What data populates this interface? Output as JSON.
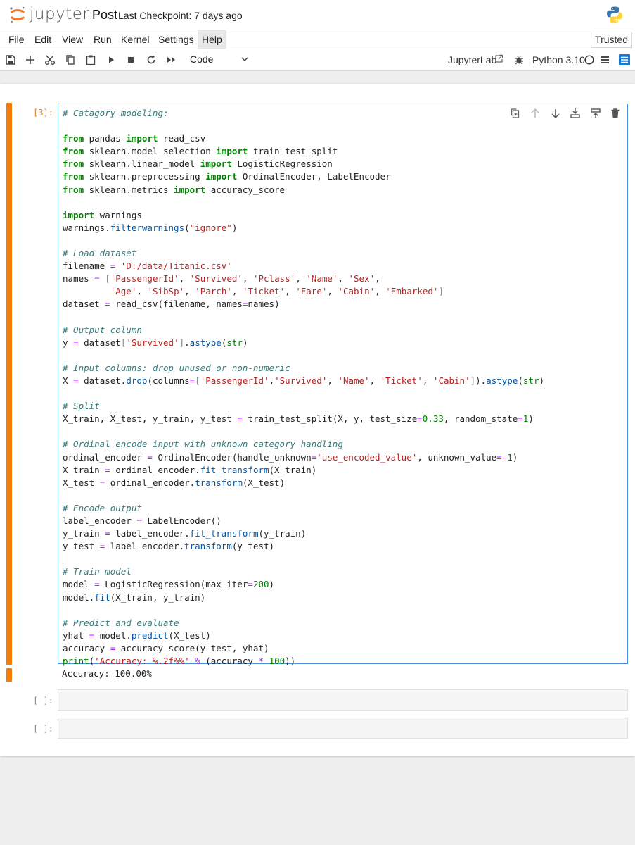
{
  "header": {
    "brand": "jupyter",
    "notebook_title": "Post",
    "checkpoint": "Last Checkpoint: 7 days ago"
  },
  "menu": [
    "File",
    "Edit",
    "View",
    "Run",
    "Kernel",
    "Settings",
    "Help"
  ],
  "trusted_label": "Trusted",
  "toolbar": {
    "cell_type": "Code",
    "jupyterlab_label": "JupyterLab",
    "kernel_name": "Python 3.10"
  },
  "cells": [
    {
      "prompt": "[3]:",
      "code": [
        "# Catagory modeling:",
        "",
        "from pandas import read_csv",
        "from sklearn.model_selection import train_test_split",
        "from sklearn.linear_model import LogisticRegression",
        "from sklearn.preprocessing import OrdinalEncoder, LabelEncoder",
        "from sklearn.metrics import accuracy_score",
        "",
        "import warnings",
        "warnings.filterwarnings(\"ignore\")",
        "",
        "# Load dataset",
        "filename = 'D:/data/Titanic.csv'",
        "names = ['PassengerId', 'Survived', 'Pclass', 'Name', 'Sex',",
        "         'Age', 'SibSp', 'Parch', 'Ticket', 'Fare', 'Cabin', 'Embarked']",
        "dataset = read_csv(filename, names=names)",
        "",
        "# Output column",
        "y = dataset['Survived'].astype(str)",
        "",
        "# Input columns: drop unused or non-numeric",
        "X = dataset.drop(columns=['PassengerId','Survived', 'Name', 'Ticket', 'Cabin']).astype(str)",
        "",
        "# Split",
        "X_train, X_test, y_train, y_test = train_test_split(X, y, test_size=0.33, random_state=1)",
        "",
        "# Ordinal encode input with unknown category handling",
        "ordinal_encoder = OrdinalEncoder(handle_unknown='use_encoded_value', unknown_value=-1)",
        "X_train = ordinal_encoder.fit_transform(X_train)",
        "X_test = ordinal_encoder.transform(X_test)",
        "",
        "# Encode output",
        "label_encoder = LabelEncoder()",
        "y_train = label_encoder.fit_transform(y_train)",
        "y_test = label_encoder.transform(y_test)",
        "",
        "# Train model",
        "model = LogisticRegression(max_iter=200)",
        "model.fit(X_train, y_train)",
        "",
        "# Predict and evaluate",
        "yhat = model.predict(X_test)",
        "accuracy = accuracy_score(y_test, yhat)",
        "print('Accuracy: %.2f%%' % (accuracy * 100))"
      ],
      "output": "Accuracy: 100.00%"
    },
    {
      "prompt": "[ ]:"
    },
    {
      "prompt": "[ ]:"
    }
  ],
  "colors": {
    "accent": "#f57c00",
    "editor_border": "#4a90e2",
    "comment": "#3a7a7a",
    "keyword": "#008000",
    "string": "#ba2121"
  },
  "icons": [
    "jupyter-logo-icon",
    "python-logo-icon",
    "save-icon",
    "add-cell-icon",
    "cut-icon",
    "copy-icon",
    "paste-icon",
    "run-icon",
    "stop-icon",
    "restart-icon",
    "run-all-icon",
    "chevron-down-icon",
    "external-link-icon",
    "debug-icon",
    "kernel-status-icon",
    "kernel-menu-icon",
    "toc-icon",
    "duplicate-cell-icon",
    "move-up-icon",
    "move-down-icon",
    "insert-above-icon",
    "insert-below-icon",
    "delete-cell-icon"
  ]
}
